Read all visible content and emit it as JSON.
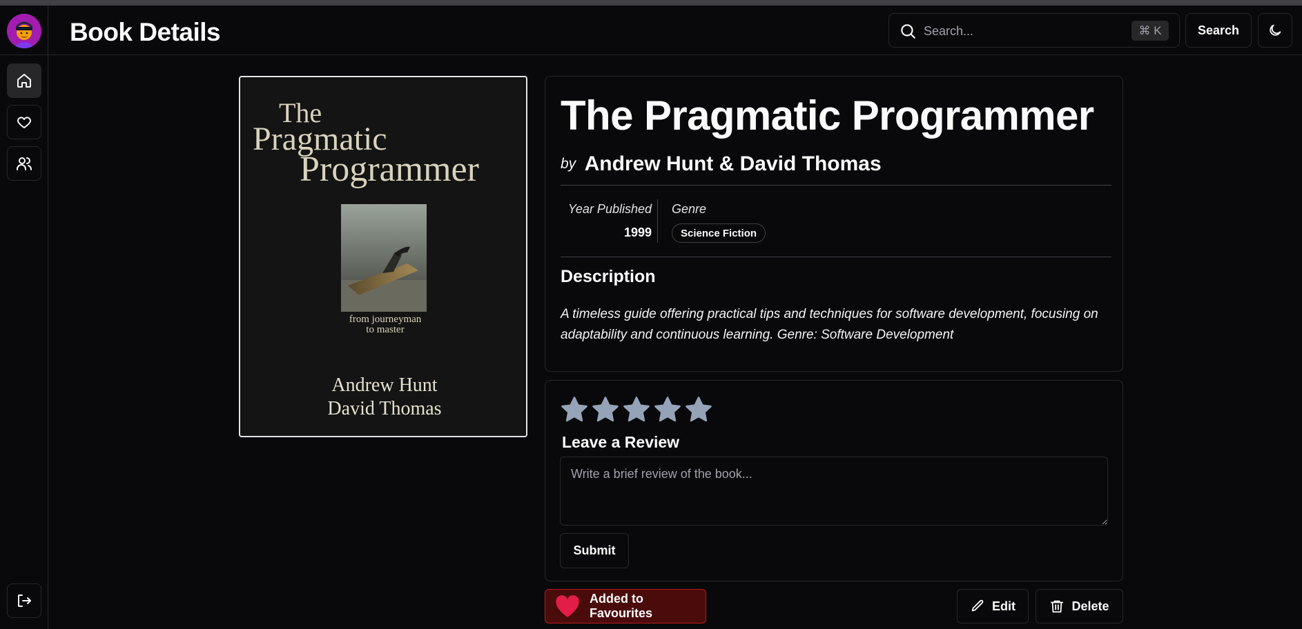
{
  "header": {
    "title": "Book Details",
    "search_placeholder": "Search...",
    "shortcut": "⌘ K",
    "search_button": "Search"
  },
  "sidebar": {
    "items": [
      {
        "icon": "home-icon",
        "active": true
      },
      {
        "icon": "heart-icon",
        "active": false
      },
      {
        "icon": "users-icon",
        "active": false
      }
    ],
    "bottom_icon": "logout-icon"
  },
  "cover": {
    "title_lines": [
      "The",
      "Pragmatic",
      "Programmer"
    ],
    "subtitle_lines": [
      "from journeyman",
      "to master"
    ],
    "author_lines": [
      "Andrew Hunt",
      "David Thomas"
    ]
  },
  "book": {
    "title": "The Pragmatic Programmer",
    "by_label": "by",
    "author": "Andrew Hunt & David Thomas",
    "year_label": "Year Published",
    "year": "1999",
    "genre_label": "Genre",
    "genre": "Science Fiction",
    "description_heading": "Description",
    "description": "A timeless guide offering practical tips and techniques for software development, focusing on adaptability and continuous learning. Genre: Software Development"
  },
  "review": {
    "rating": 0,
    "max_rating": 5,
    "heading": "Leave a Review",
    "placeholder": "Write a brief review of the book...",
    "submit_label": "Submit"
  },
  "actions": {
    "favourite_label": "Added to Favourites",
    "edit_label": "Edit",
    "delete_label": "Delete"
  },
  "colors": {
    "background": "#09090b",
    "border": "#27272a",
    "favourite_bg": "#4a0b0b",
    "favourite_heart": "#e11d48",
    "star": "#94a3b8"
  }
}
